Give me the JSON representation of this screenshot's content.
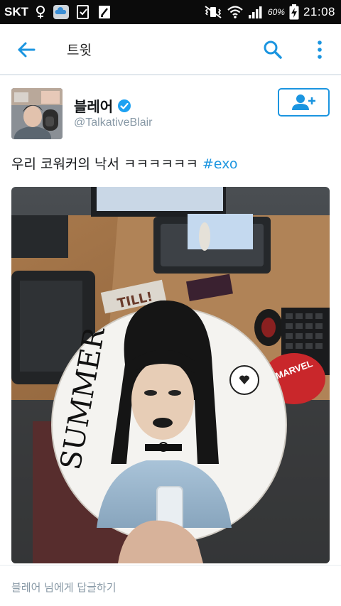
{
  "status_bar": {
    "carrier": "SKT",
    "battery_percent": "60%",
    "time": "21:08"
  },
  "app_bar": {
    "title": "트윗"
  },
  "tweet": {
    "author_name": "블레어",
    "author_handle": "@TalkativeBlair",
    "text": "우리 코워커의 낙서 ㅋㅋㅋㅋㅋㅋ",
    "hashtag": "#exo",
    "media": {
      "fan_text": "SUMMER",
      "book_text": "TILL!",
      "sticker_text": "MARVEL"
    }
  },
  "reply": {
    "placeholder": "블레어 님에게 답글하기"
  },
  "colors": {
    "accent": "#1b95e0",
    "verified": "#1da1f2",
    "secondary_text": "#8899a6"
  },
  "icons": [
    "back-arrow-icon",
    "search-icon",
    "more-vert-icon",
    "verified-badge-icon",
    "follow-user-icon"
  ]
}
